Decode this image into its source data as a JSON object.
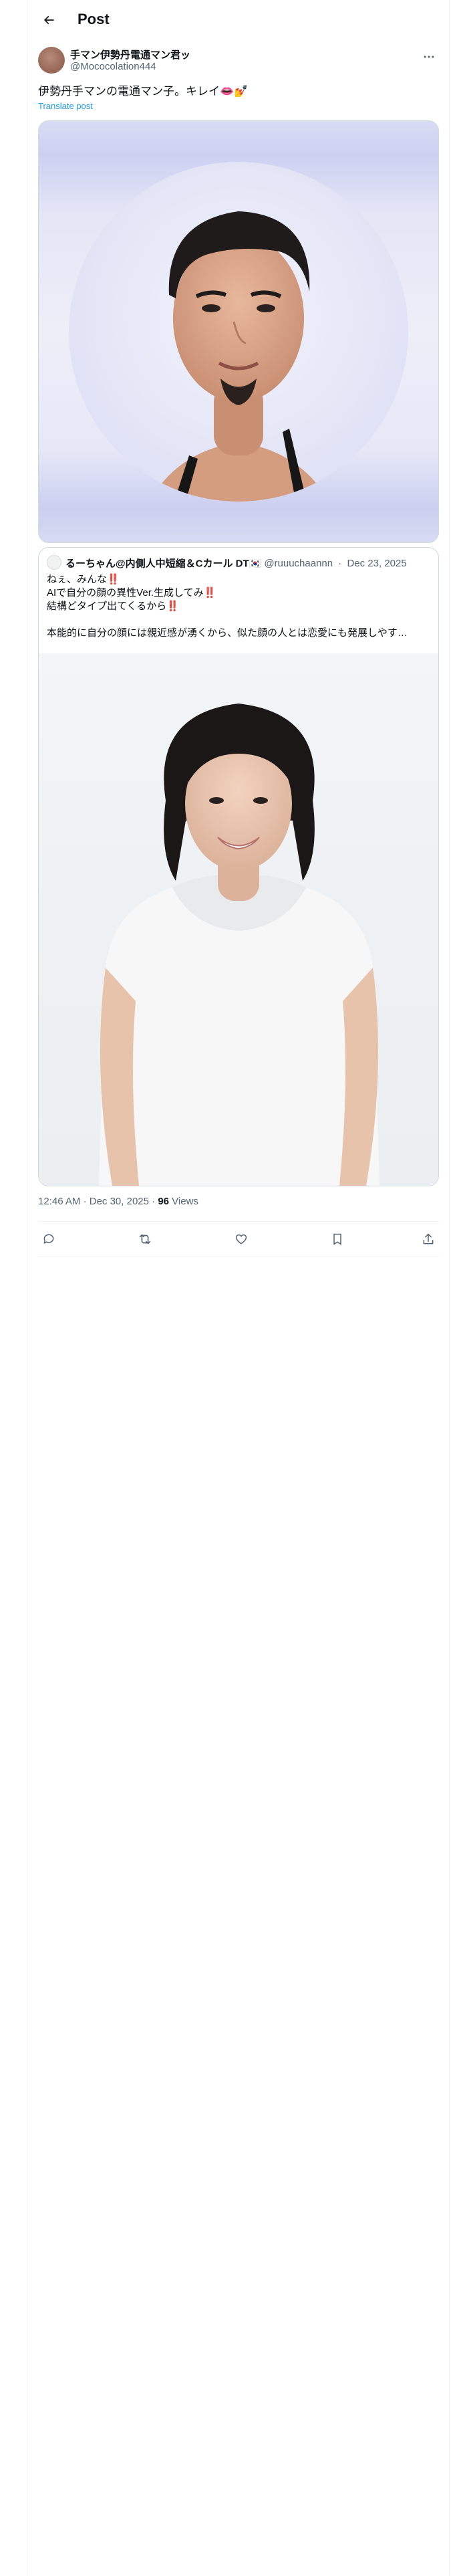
{
  "header": {
    "title": "Post",
    "back_icon": "arrow-left-icon"
  },
  "post": {
    "author": {
      "display_name": "手マン伊勢丹電通マン君ッ",
      "handle": "@Mococolation444"
    },
    "text": "伊勢丹手マンの電通マン子。キレイ👄💅",
    "translate_label": "Translate post",
    "image_alt": "Circular portrait photo on lavender background"
  },
  "quote": {
    "author": {
      "display_name": "るーちゃん@内側人中短縮＆Cカール DT🇰🇷",
      "handle": "@ruuuchaannn",
      "separator": "·",
      "date": "Dec 23, 2025"
    },
    "lines": [
      "ねぇ、みんな‼️",
      "AIで自分の顔の異性Ver.生成してみ‼️",
      "結構どタイプ出てくるから‼️",
      "",
      "本能的に自分の顔には親近感が湧くから、似た顔の人とは恋愛にも発展しやす…"
    ]
  },
  "meta": {
    "time": "12:46 AM",
    "separator": "·",
    "date": "Dec 30, 2025",
    "separator2": "·",
    "views_count": "96",
    "views_label": "Views"
  },
  "actions": [
    {
      "icon": "reply-icon"
    },
    {
      "icon": "repost-icon"
    },
    {
      "icon": "like-icon"
    },
    {
      "icon": "bookmark-icon"
    },
    {
      "icon": "share-icon"
    }
  ],
  "colors": {
    "accent": "#1d9bf0",
    "text": "#0f1419",
    "secondary": "#536471",
    "border": "#cfd9de"
  }
}
